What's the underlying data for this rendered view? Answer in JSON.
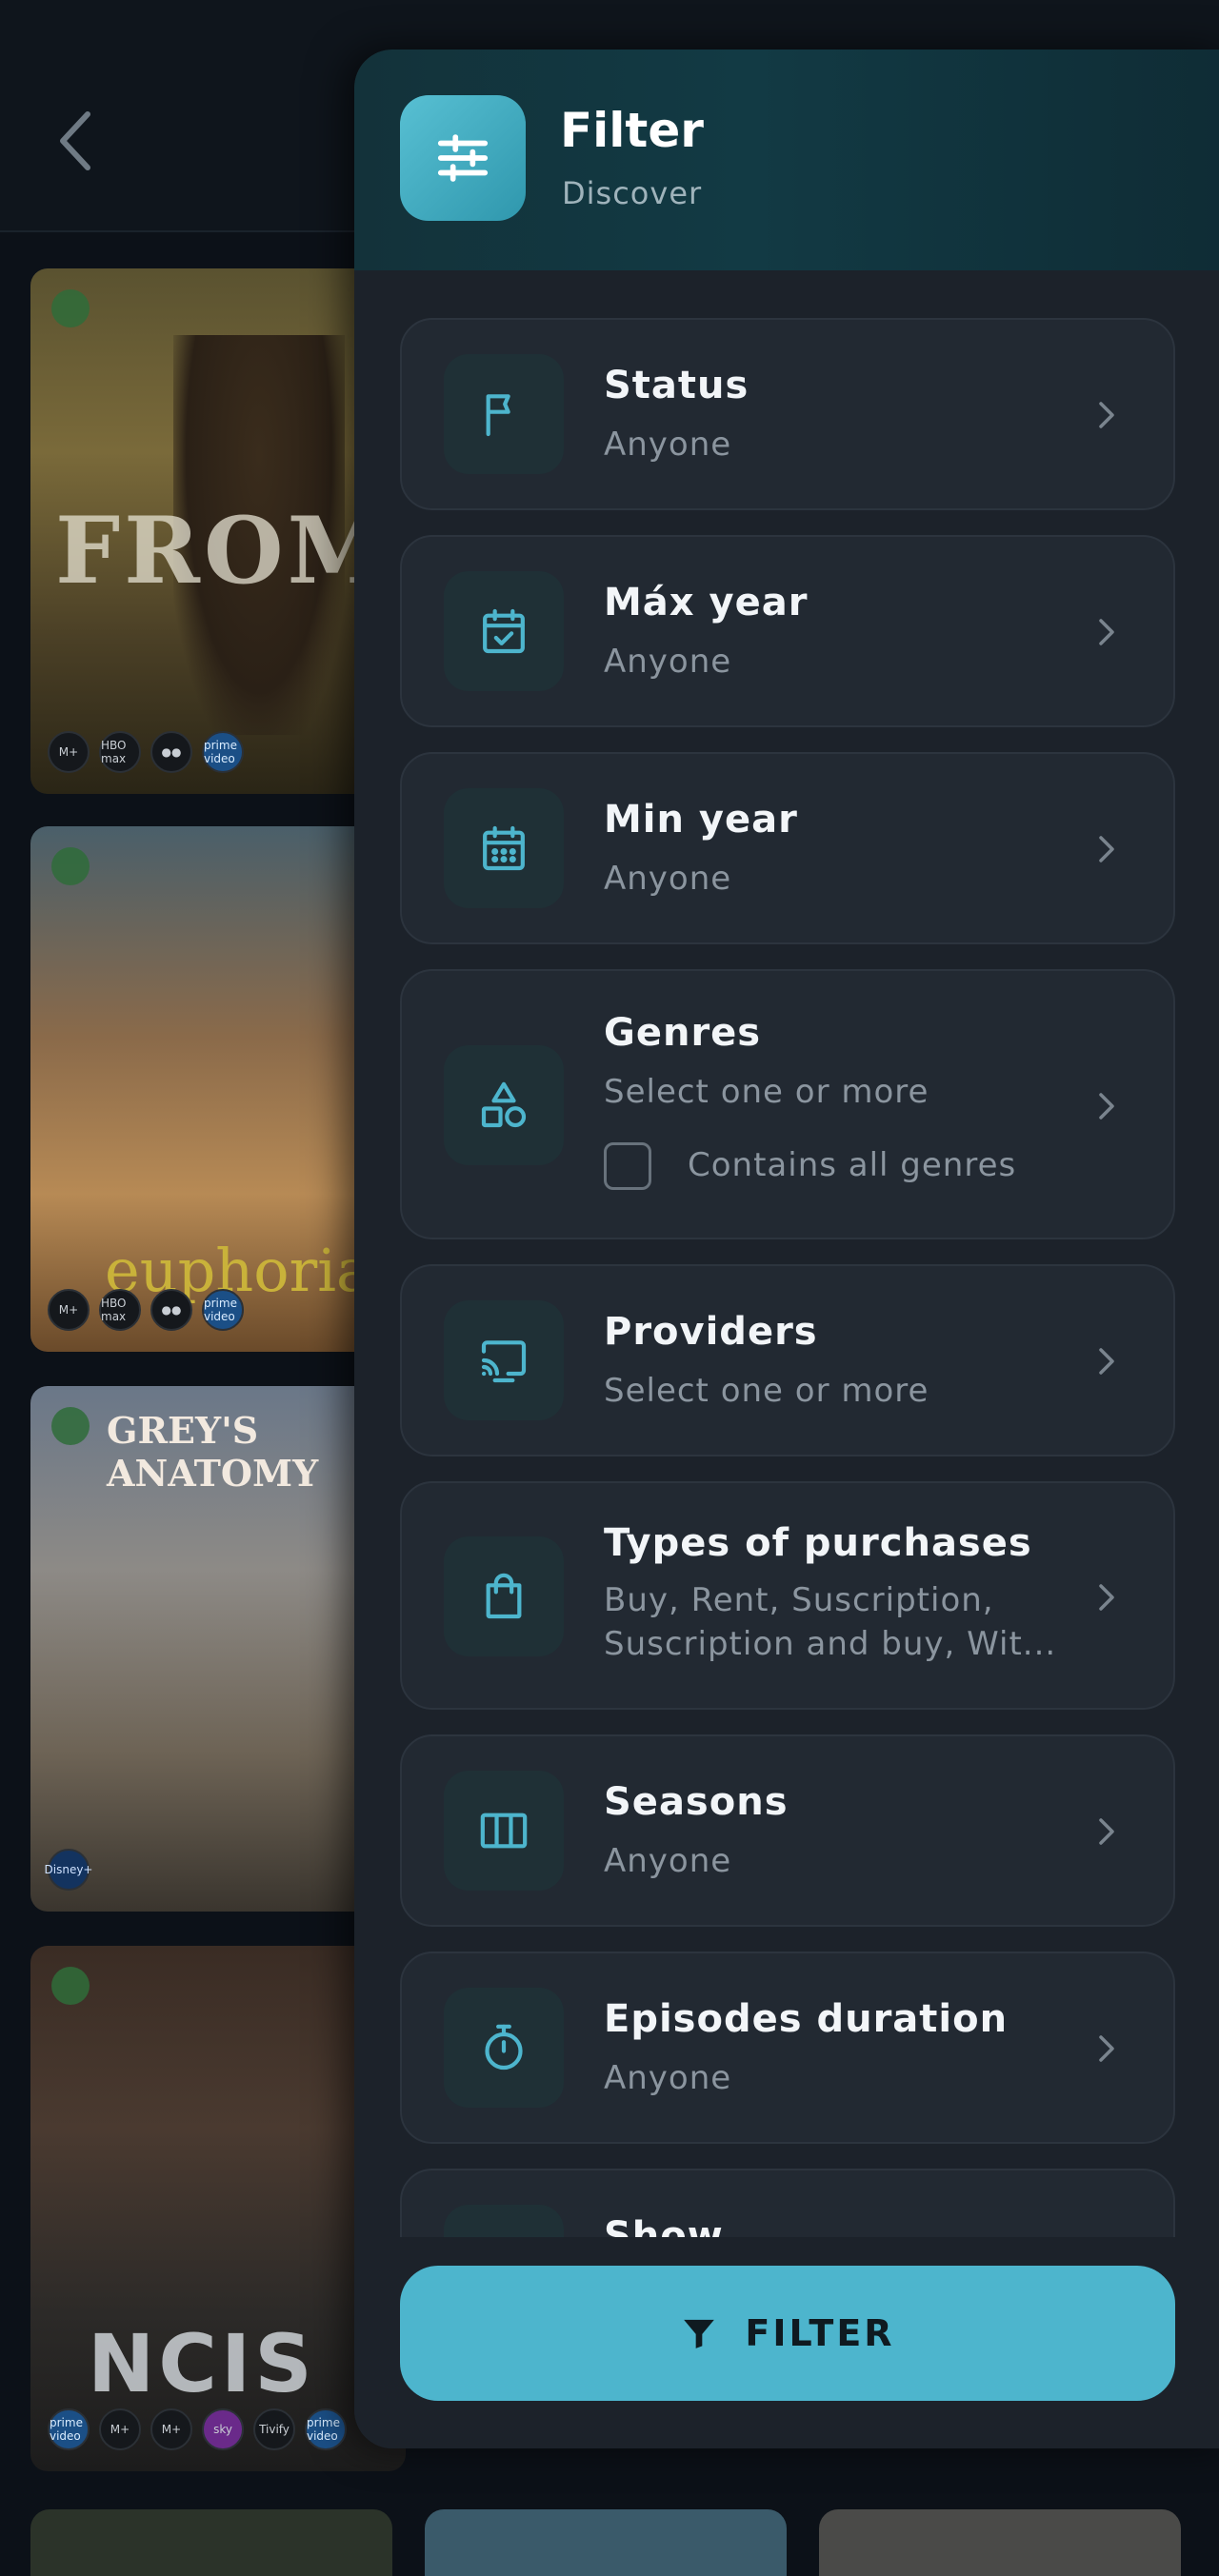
{
  "background": {
    "posters": [
      {
        "title_text": "FROM",
        "badges": [
          "M+",
          "HBO max",
          "●●",
          "prime video"
        ]
      },
      {
        "title_text": "euphoria",
        "badges": [
          "M+",
          "HBO max",
          "●●",
          "prime video"
        ]
      },
      {
        "title_text": "GREY'S ANATOMY",
        "badges": [
          "Disney+"
        ]
      },
      {
        "title_text": "NCIS",
        "badges": [
          "prime video",
          "M+",
          "M+",
          "sky",
          "Tivify",
          "prime video"
        ]
      }
    ]
  },
  "drawer": {
    "title": "Filter",
    "subtitle": "Discover",
    "items": [
      {
        "label": "Status",
        "value": "Anyone",
        "icon": "flag-icon"
      },
      {
        "label": "Máx year",
        "value": "Anyone",
        "icon": "calendar-check-icon"
      },
      {
        "label": "Min year",
        "value": "Anyone",
        "icon": "calendar-icon"
      },
      {
        "label": "Genres",
        "value": "Select one or more",
        "icon": "shapes-icon",
        "checkbox_label": "Contains all genres",
        "checked": false
      },
      {
        "label": "Providers",
        "value": "Select one or more",
        "icon": "cast-icon"
      },
      {
        "label": "Types of purchases",
        "value_line1": "Buy, Rent, Suscription,",
        "value_line2": "Suscription and buy, Wit...",
        "icon": "shopping-bag-icon"
      },
      {
        "label": "Seasons",
        "value": "Anyone",
        "icon": "columns-icon"
      },
      {
        "label": "Episodes duration",
        "value": "Anyone",
        "icon": "stopwatch-icon"
      },
      {
        "label": "Show",
        "icon": "show-icon"
      }
    ],
    "filter_button_label": "FILTER"
  },
  "colors": {
    "accent": "#4db5cd",
    "drawer_bg": "#1c222a",
    "card_bg": "#222932"
  }
}
